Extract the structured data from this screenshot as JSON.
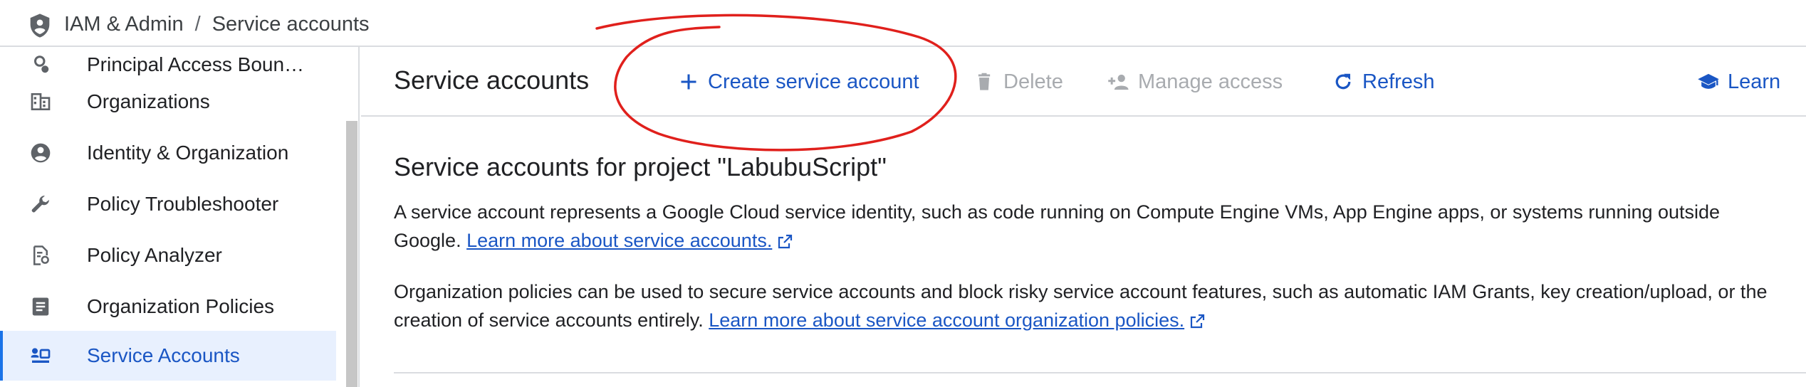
{
  "breadcrumb": {
    "parent": "IAM & Admin",
    "separator": "/",
    "current": "Service accounts"
  },
  "sidebar": {
    "items": [
      {
        "label": "Principal Access Boun…",
        "icon": "principal-access-icon"
      },
      {
        "label": "Organizations",
        "icon": "organizations-icon"
      },
      {
        "label": "Identity & Organization",
        "icon": "account-circle-icon"
      },
      {
        "label": "Policy Troubleshooter",
        "icon": "wrench-icon"
      },
      {
        "label": "Policy Analyzer",
        "icon": "policy-analyzer-icon"
      },
      {
        "label": "Organization Policies",
        "icon": "document-list-icon"
      },
      {
        "label": "Service Accounts",
        "icon": "service-account-icon",
        "active": true
      }
    ]
  },
  "toolbar": {
    "title": "Service accounts",
    "create_label": "Create service account",
    "delete_label": "Delete",
    "manage_label": "Manage access",
    "refresh_label": "Refresh",
    "learn_label": "Learn"
  },
  "content": {
    "heading": "Service accounts for project \"LabubuScript\"",
    "para1_text": "A service account represents a Google Cloud service identity, such as code running on Compute Engine VMs, App Engine apps, or systems running outside Google.",
    "para1_link": "Learn more about service accounts.",
    "para2_text": "Organization policies can be used to secure service accounts and block risky service account features, such as automatic IAM Grants, key creation/upload, or the creation of service accounts entirely.",
    "para2_link": "Learn more about service account organization policies."
  },
  "colors": {
    "accent": "#1a73e8",
    "link": "#1a56c4",
    "active_bg": "#e8f0fe",
    "disabled": "#a8abaf",
    "annotation": "#e0201c"
  }
}
